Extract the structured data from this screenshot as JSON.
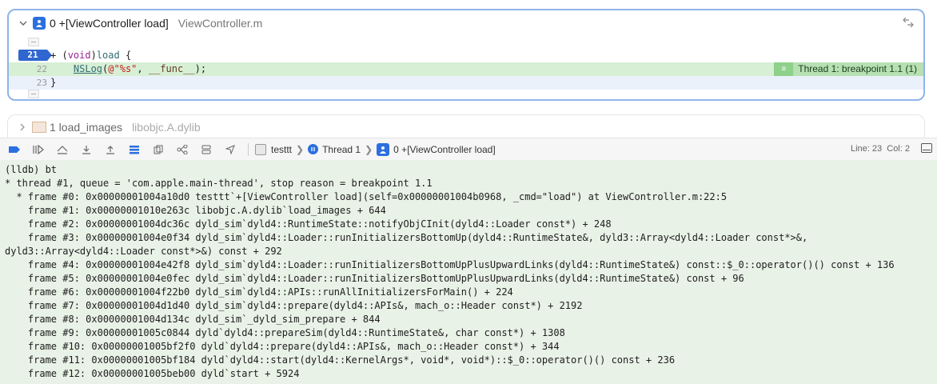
{
  "frame0": {
    "function_name": "0 +[ViewController load]",
    "file_name": "ViewController.m",
    "lines": [
      {
        "number": "21",
        "text_parts": [
          "+ (",
          "void",
          ")",
          "load",
          " {"
        ]
      },
      {
        "number": "22",
        "text_parts": [
          "    ",
          "NSLog",
          "(",
          "@\"%s\"",
          ", ",
          "__func__",
          ");"
        ]
      },
      {
        "number": "23",
        "text_parts": [
          "}"
        ]
      }
    ],
    "breakpoint_label": "Thread 1: breakpoint 1.1 (1)"
  },
  "frame1": {
    "function_name": "1 load_images",
    "library": "libobjc.A.dylib"
  },
  "toolbar": {
    "target": "testtt",
    "thread": "Thread 1",
    "frame": "0 +[ViewController load]",
    "line_info": "Line: 23",
    "col_info": "Col: 2"
  },
  "console": {
    "lines": [
      "(lldb) bt",
      "* thread #1, queue = 'com.apple.main-thread', stop reason = breakpoint 1.1",
      "  * frame #0: 0x00000001004a10d0 testtt`+[ViewController load](self=0x00000001004b0968, _cmd=\"load\") at ViewController.m:22:5",
      "    frame #1: 0x00000001010e263c libobjc.A.dylib`load_images + 644",
      "    frame #2: 0x00000001004dc36c dyld_sim`dyld4::RuntimeState::notifyObjCInit(dyld4::Loader const*) + 248",
      "    frame #3: 0x00000001004e0f34 dyld_sim`dyld4::Loader::runInitializersBottomUp(dyld4::RuntimeState&, dyld3::Array<dyld4::Loader const*>&,",
      "dyld3::Array<dyld4::Loader const*>&) const + 292",
      "    frame #4: 0x00000001004e42f8 dyld_sim`dyld4::Loader::runInitializersBottomUpPlusUpwardLinks(dyld4::RuntimeState&) const::$_0::operator()() const + 136",
      "    frame #5: 0x00000001004e0fec dyld_sim`dyld4::Loader::runInitializersBottomUpPlusUpwardLinks(dyld4::RuntimeState&) const + 96",
      "    frame #6: 0x00000001004f22b0 dyld_sim`dyld4::APIs::runAllInitializersForMain() + 224",
      "    frame #7: 0x00000001004d1d40 dyld_sim`dyld4::prepare(dyld4::APIs&, mach_o::Header const*) + 2192",
      "    frame #8: 0x00000001004d134c dyld_sim`_dyld_sim_prepare + 844",
      "    frame #9: 0x00000001005c0844 dyld`dyld4::prepareSim(dyld4::RuntimeState&, char const*) + 1308",
      "    frame #10: 0x00000001005bf2f0 dyld`dyld4::prepare(dyld4::APIs&, mach_o::Header const*) + 344",
      "    frame #11: 0x00000001005bf184 dyld`dyld4::start(dyld4::KernelArgs*, void*, void*)::$_0::operator()() const + 236",
      "    frame #12: 0x00000001005beb00 dyld`start + 5924"
    ]
  }
}
